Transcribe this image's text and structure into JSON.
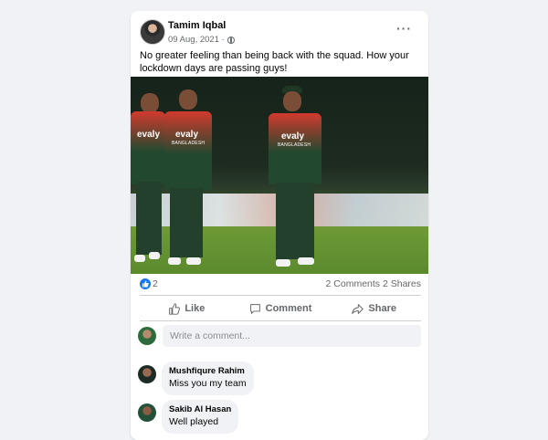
{
  "post": {
    "author": "Tamim Iqbal",
    "date": "09 Aug, 2021 ·",
    "more_icon": "more-horizontal-icon",
    "text": "No greater feeling than being back with the squad. How your lockdown days are passing guys!",
    "photo": {
      "jersey_brand": "evaly",
      "jersey_country": "BANGLADESH"
    }
  },
  "stats": {
    "likes": "2",
    "comments": "2 Comments",
    "shares": "2 Shares"
  },
  "actions": {
    "like": "Like",
    "comment": "Comment",
    "share": "Share"
  },
  "composer": {
    "placeholder": "Write a comment..."
  },
  "comments": [
    {
      "name": "Mushfiqure Rahim",
      "text": "Miss you my team"
    },
    {
      "name": "Sakib Al Hasan",
      "text": "Well played"
    }
  ],
  "colors": {
    "accent": "#1877f2",
    "background": "#f0f2f5",
    "muted": "#65676b"
  }
}
